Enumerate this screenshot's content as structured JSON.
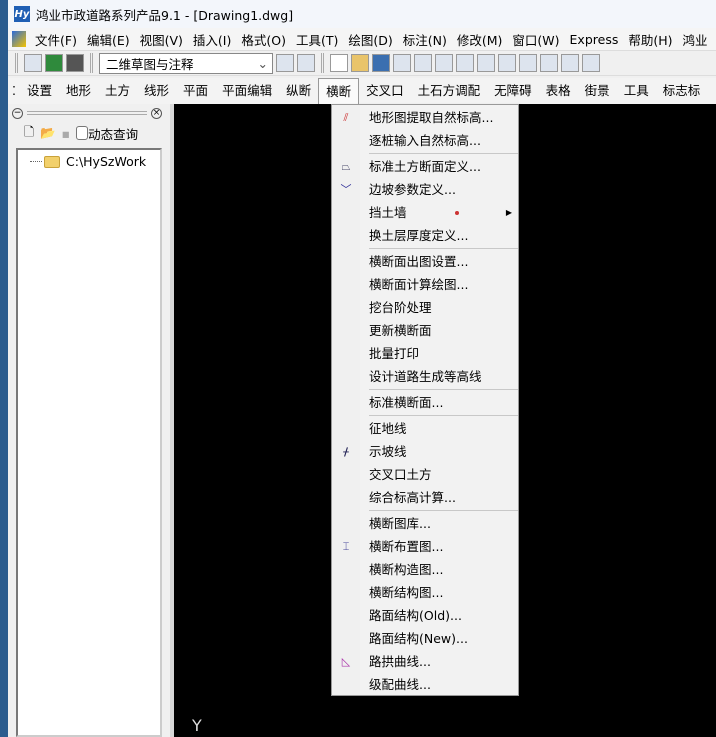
{
  "window": {
    "title": "鸿业市政道路系列产品9.1 - [Drawing1.dwg]",
    "logo": "Hy"
  },
  "menubar": [
    "文件(F)",
    "编辑(E)",
    "视图(V)",
    "插入(I)",
    "格式(O)",
    "工具(T)",
    "绘图(D)",
    "标注(N)",
    "修改(M)",
    "窗口(W)",
    "Express",
    "帮助(H)",
    "鸿业"
  ],
  "toolbar": {
    "workspace": "二维草图与注释"
  },
  "tabs": [
    "设置",
    "地形",
    "土方",
    "线形",
    "平面",
    "平面编辑",
    "纵断",
    "横断",
    "交叉口",
    "土石方调配",
    "无障碍",
    "表格",
    "街景",
    "工具",
    "标志标"
  ],
  "active_tab": "横断",
  "panel": {
    "dynamic_query": "动态查询",
    "tree_root": "C:\\HySzWork"
  },
  "canvas": {
    "axis_label": "Y"
  },
  "dropdown": [
    {
      "label": "地形图提取自然标高...",
      "icon": "terrain-hatch-icon"
    },
    {
      "label": "逐桩输入自然标高..."
    },
    {
      "sep": true
    },
    {
      "label": "标准土方断面定义...",
      "icon": "section-icon"
    },
    {
      "label": "边坡参数定义...",
      "icon": "slope-icon"
    },
    {
      "label": "挡土墙",
      "submenu": true
    },
    {
      "label": "换土层厚度定义..."
    },
    {
      "sep": true
    },
    {
      "label": "横断面出图设置..."
    },
    {
      "label": "横断面计算绘图..."
    },
    {
      "label": "挖台阶处理"
    },
    {
      "label": "更新横断面"
    },
    {
      "label": "批量打印"
    },
    {
      "label": "设计道路生成等高线"
    },
    {
      "sep": true
    },
    {
      "label": "标准横断面..."
    },
    {
      "sep": true
    },
    {
      "label": "征地线"
    },
    {
      "label": "示坡线",
      "icon": "slope-line-icon"
    },
    {
      "label": "交叉口土方"
    },
    {
      "label": "综合标高计算..."
    },
    {
      "sep": true
    },
    {
      "label": "横断图库..."
    },
    {
      "label": "横断布置图...",
      "icon": "layout-icon"
    },
    {
      "label": "横断构造图..."
    },
    {
      "label": "横断结构图..."
    },
    {
      "label": "路面结构(Old)..."
    },
    {
      "label": "路面结构(New)..."
    },
    {
      "label": "路拱曲线...",
      "icon": "crown-curve-icon"
    },
    {
      "label": "级配曲线..."
    }
  ]
}
